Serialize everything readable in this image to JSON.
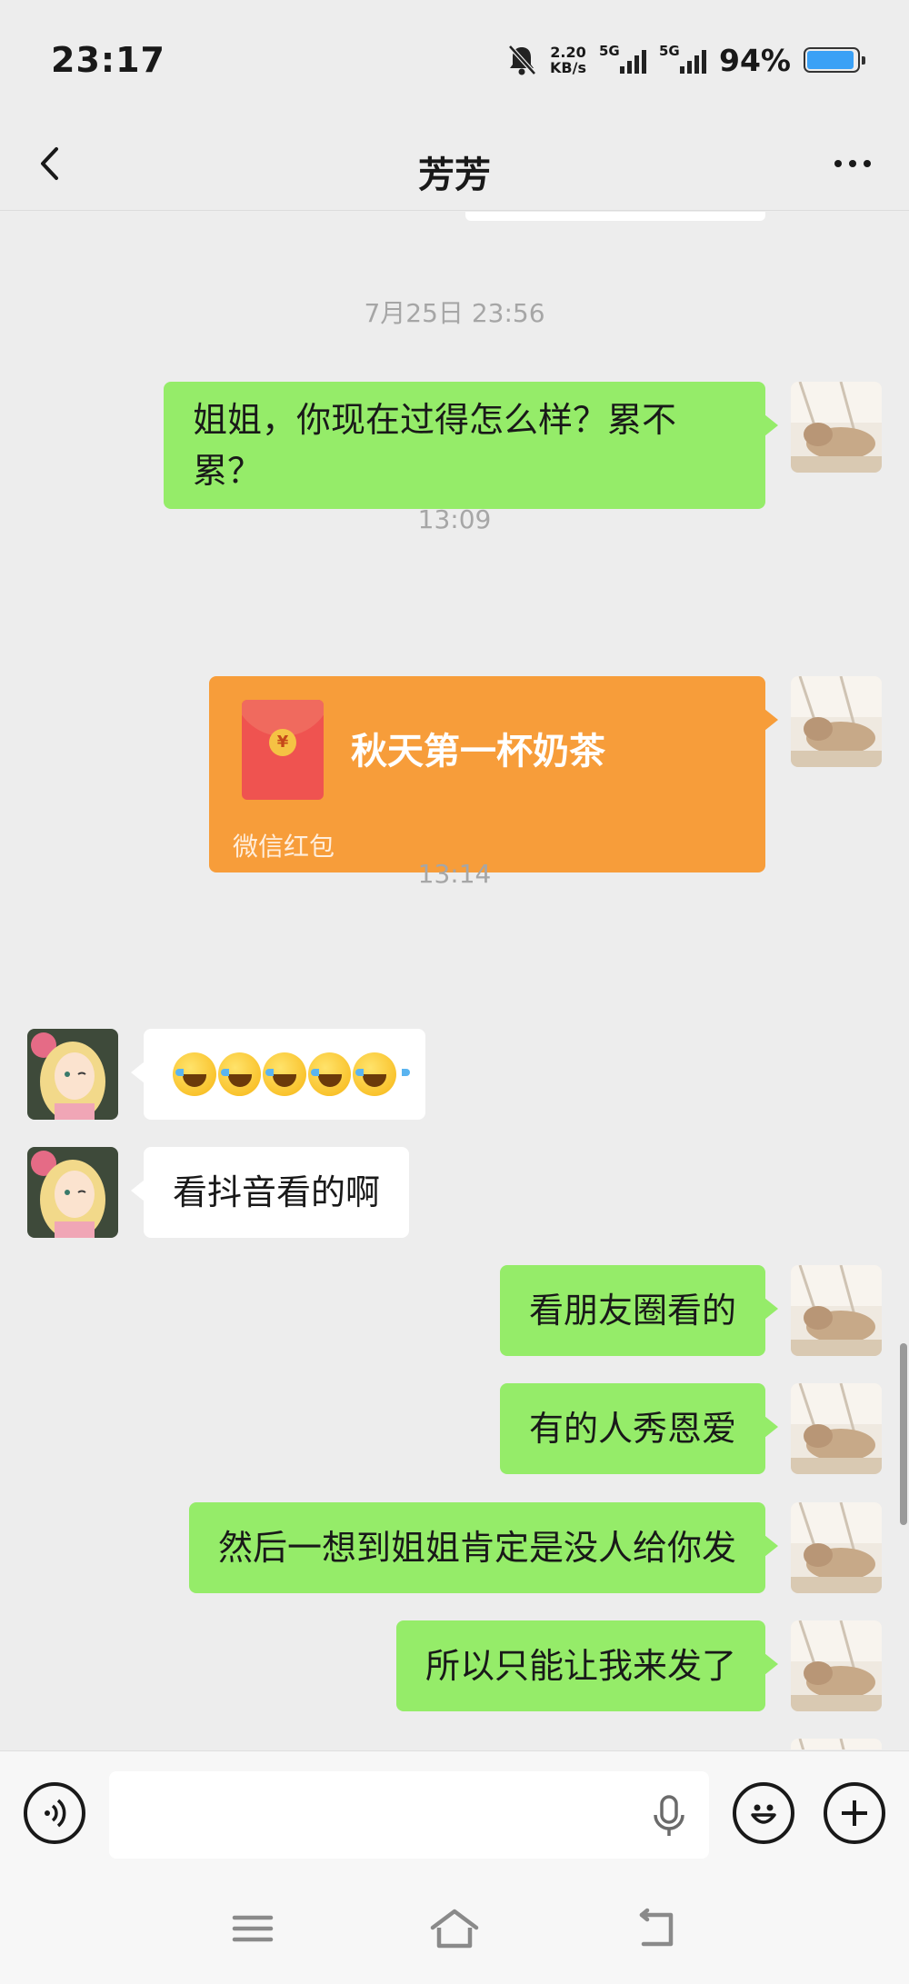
{
  "status_bar": {
    "time": "23:17",
    "net_speed_value": "2.20",
    "net_speed_unit": "KB/s",
    "sim1_tag": "5G",
    "sim2_tag": "5G",
    "battery_text": "94%",
    "battery_level": 0.94,
    "icons": [
      "bell-muted-icon",
      "signal-icon",
      "battery-icon"
    ]
  },
  "nav": {
    "title": "芳芳",
    "back_icon": "chevron-left-icon",
    "more_icon": "more-dots-icon"
  },
  "messages": {
    "ts1": "7月25日 23:56",
    "m1": "姐姐，你现在过得怎么样？累不累？",
    "ts2": "13:09",
    "packet_title": "秋天第一杯奶茶",
    "packet_label": "微信红包",
    "ts3": "13:14",
    "m2_emoji_count": 5,
    "m3": "看抖音看的啊",
    "m4": "看朋友圈看的",
    "m5": "有的人秀恩爱",
    "m6": "然后一想到姐姐肯定是没人给你发",
    "m7": "所以只能让我来发了"
  },
  "input_bar": {
    "value": "",
    "icons": [
      "voice-icon",
      "mic-icon",
      "emoji-icon",
      "plus-icon"
    ]
  },
  "system_nav": {
    "icons": [
      "menu-icon",
      "home-icon",
      "back-icon"
    ]
  },
  "colors": {
    "background": "#ededed",
    "my_bubble": "#95ec69",
    "their_bubble": "#ffffff",
    "red_packet": "#f79d3a",
    "timestamp": "#a6a6a6"
  }
}
